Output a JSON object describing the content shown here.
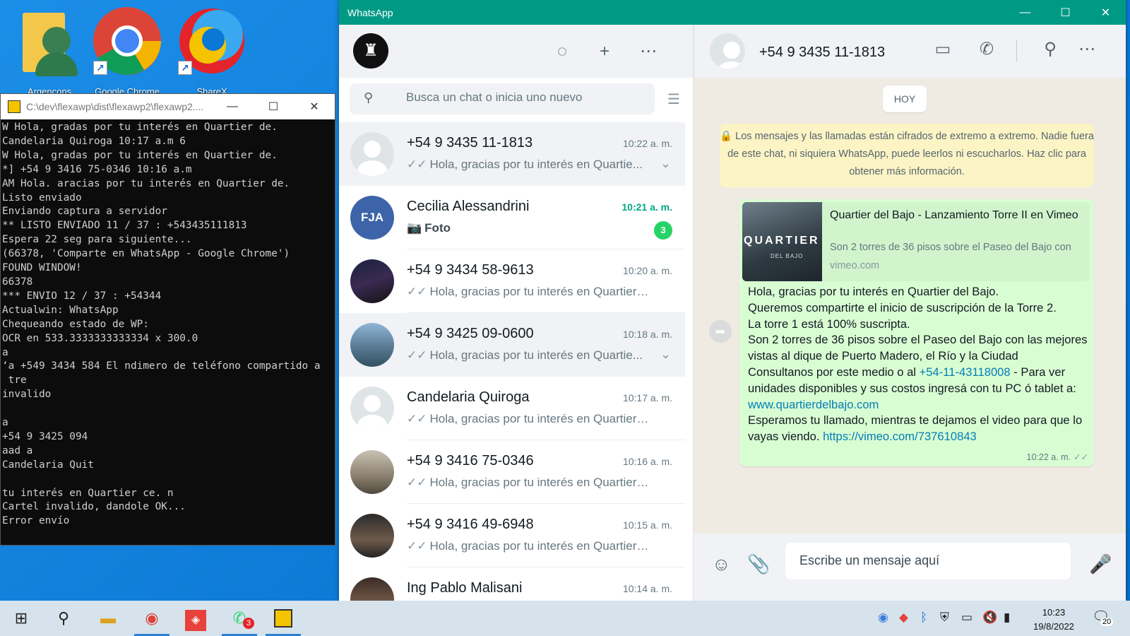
{
  "desktop": {
    "icons": [
      {
        "label": "Argencons"
      },
      {
        "label": "Google Chrome"
      },
      {
        "label": "ShareX"
      }
    ]
  },
  "console": {
    "title": "C:\\dev\\flexawp\\dist\\flexawp2\\flexawp2....",
    "lines": "W Hola, gradas por tu interés en Quartier de.\nCandelaria Quiroga 10:17 a.m 6\nW Hola, gradas por tu interés en Quartier de.\n*] +54 9 3416 75-0346 10:16 a.m\nAM Hola. aracias por tu interés en Quartier de.\nListo enviado\nEnviando captura a servidor\n** LISTO ENVIADO 11 / 37 : +543435111813\nEspera 22 seg para siguiente...\n(66378, 'Comparte en WhatsApp - Google Chrome')\nFOUND WINDOW!\n66378\n*** ENVIO 12 / 37 : +54344\nActualwin: WhatsApp\nChequeando estado de WP:\nOCR en 533.3333333333334 x 300.0\na\n‘a +549 3434 584 El ndimero de teléfono compartido a\n tre\ninvalido\n\na\n+54 9 3425 094\naad a\nCandelaria Quit\n\ntu interés en Quartier ce. n\nCartel invalido, dandole OK...\nError envío"
  },
  "whatsapp": {
    "title": "WhatsApp",
    "search_placeholder": "Busca un chat o inicia uno nuevo",
    "chats": [
      {
        "name": "+54 9 3435 11-1813",
        "time": "10:22 a. m.",
        "preview": "Hola, gracias por tu interés en Quartie..."
      },
      {
        "name": "Cecilia Alessandrini",
        "time": "10:21 a. m.",
        "preview": "Foto",
        "badge": "3",
        "avatar_text": "FJA"
      },
      {
        "name": "+54 9 3434 58-9613",
        "time": "10:20 a. m.",
        "preview": "Hola, gracias por tu interés en Quartier de..."
      },
      {
        "name": "+54 9 3425 09-0600",
        "time": "10:18 a. m.",
        "preview": "Hola, gracias por tu interés en Quartie..."
      },
      {
        "name": "Candelaria Quiroga",
        "time": "10:17 a. m.",
        "preview": "Hola, gracias por tu interés en Quartier de..."
      },
      {
        "name": "+54 9 3416 75-0346",
        "time": "10:16 a. m.",
        "preview": "Hola, gracias por tu interés en Quartier de..."
      },
      {
        "name": "+54 9 3416 49-6948",
        "time": "10:15 a. m.",
        "preview": "Hola, gracias por tu interés en Quartier de..."
      },
      {
        "name": "Ing Pablo Malisani",
        "time": "10:14 a. m.",
        "preview": ""
      }
    ],
    "conversation": {
      "contact": "+54 9 3435 11-1813",
      "day_chip": "HOY",
      "encryption_notice": "Los mensajes y las llamadas están cifrados de extremo a extremo. Nadie fuera de este chat, ni siquiera WhatsApp, puede leerlos ni escucharlos. Haz clic para obtener más información.",
      "link_preview": {
        "title": "Quartier del Bajo - Lanzamiento Torre II en Vimeo",
        "description": "Son 2 torres de 36 pisos sobre el Paseo del Bajo con",
        "domain": "vimeo.com",
        "thumb_text": "QUARTIER",
        "thumb_sub": "DEL BAJO"
      },
      "message": {
        "p1": "Hola, gracias por tu interés en Quartier del Bajo.\nQueremos compartirte el inicio de suscripción de la Torre 2.\nLa torre 1 está 100% suscripta.\nSon 2 torres de 36 pisos sobre el Paseo del Bajo con las mejores vistas al dique de Puerto Madero, el Río y la Ciudad\nConsultanos por este medio o al ",
        "phone": "+54-11-43118008",
        "p2": " - Para ver unidades disponibles y sus costos ingresá con tu PC ó tablet a: ",
        "site": "www.quartierdelbajo.com",
        "p3": "\nEsperamos tu llamado, mientras te dejamos el video para que lo vayas viendo. ",
        "video": "https://vimeo.com/737610843",
        "time": "10:22 a. m."
      },
      "composer_placeholder": "Escribe un mensaje aquí"
    }
  },
  "taskbar": {
    "whatsapp_badge": "3",
    "time": "10:23",
    "date": "19/8/2022",
    "notifications": "20"
  }
}
